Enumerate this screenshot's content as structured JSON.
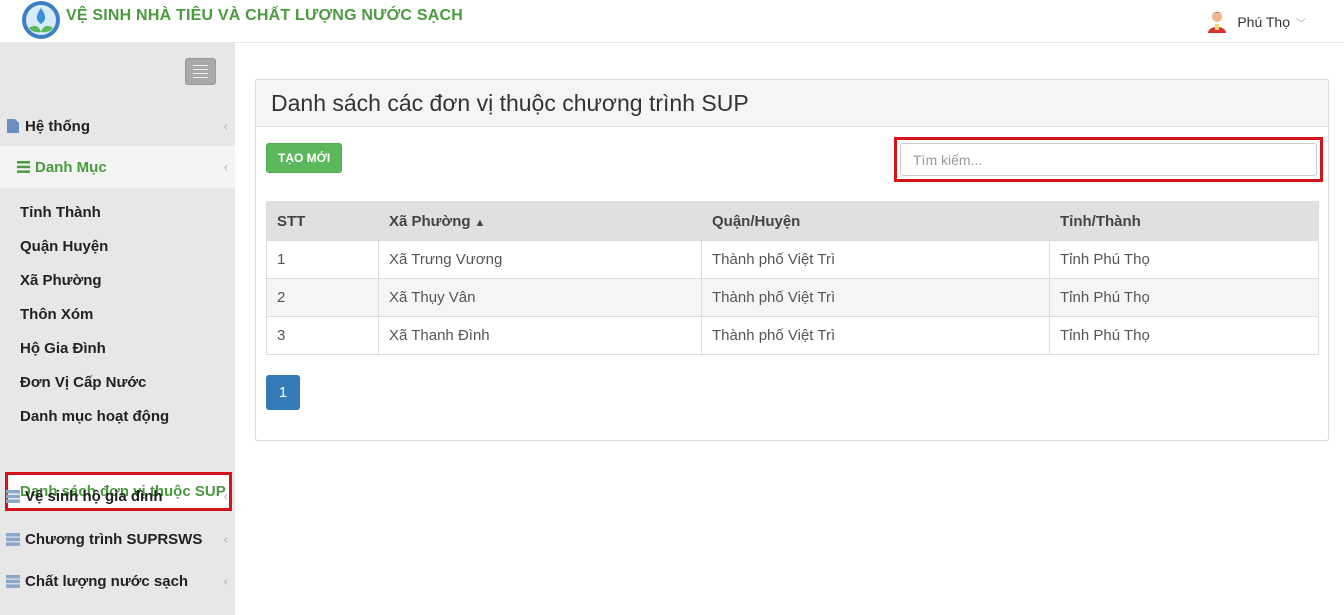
{
  "header": {
    "app_title": "VỆ SINH NHÀ TIÊU VÀ CHẤT LƯỢNG NƯỚC SẠCH",
    "user_name": "Phú Thọ",
    "user_chevron_icon": "chevron-down-icon",
    "brand_color": "#4a9a3f"
  },
  "sidebar": {
    "toggle_icon": "menu-icon",
    "sections": [
      {
        "label": "Hệ thống",
        "icon": "file-icon",
        "caret": "‹"
      },
      {
        "label": "Danh Mục",
        "icon": "list-icon",
        "caret": "‹"
      },
      {
        "label": "Vệ sinh hộ gia đình",
        "icon": "server-icon",
        "caret": "‹"
      },
      {
        "label": "Chương trình SUPRSWS",
        "icon": "server-icon",
        "caret": "‹"
      },
      {
        "label": "Chất lượng nước sạch",
        "icon": "server-icon",
        "caret": "‹"
      }
    ],
    "sub_items": [
      {
        "label": "Tỉnh Thành"
      },
      {
        "label": "Quận Huyện"
      },
      {
        "label": "Xã Phường"
      },
      {
        "label": "Thôn Xóm"
      },
      {
        "label": "Hộ Gia Đình"
      },
      {
        "label": "Đơn Vị Cấp Nước"
      },
      {
        "label": "Danh mục hoạt động"
      },
      {
        "label": "Danh sách đơn vị thuộc SUP"
      }
    ],
    "highlight_color": "#d6131b"
  },
  "main": {
    "title": "Danh sách các đơn vị thuộc chương trình SUP",
    "create_button": "TẠO MỚI",
    "search_placeholder": "Tìm kiếm...",
    "table": {
      "columns": [
        "STT",
        "Xã Phường",
        "Quận/Huyện",
        "Tỉnh/Thành"
      ],
      "sort_icon": "sort-up-icon",
      "rows": [
        [
          "1",
          "Xã Trưng Vương",
          "Thành phố Việt Trì",
          "Tỉnh Phú Thọ"
        ],
        [
          "2",
          "Xã Thụy Vân",
          "Thành phố Việt Trì",
          "Tỉnh Phú Thọ"
        ],
        [
          "3",
          "Xã Thanh Đình",
          "Thành phố Việt Trì",
          "Tỉnh Phú Thọ"
        ]
      ]
    },
    "pagination": {
      "current_page": "1"
    }
  }
}
